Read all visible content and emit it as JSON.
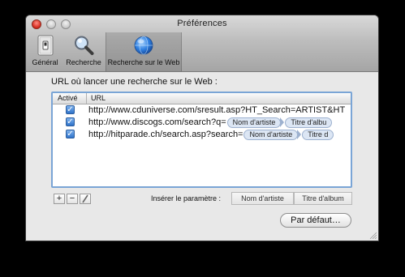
{
  "window": {
    "title": "Préférences"
  },
  "toolbar": {
    "items": [
      {
        "label": "Général",
        "icon": "general-switch-icon"
      },
      {
        "label": "Recherche",
        "icon": "magnifier-icon"
      },
      {
        "label": "Recherche sur le Web",
        "icon": "globe-icon",
        "selected": true
      }
    ]
  },
  "main": {
    "section_label": "URL où lancer une recherche sur le Web :",
    "table": {
      "columns": [
        "Activé",
        "URL"
      ],
      "rows": [
        {
          "active": true,
          "url_prefix": "http://www.cduniverse.com/sresult.asp?HT_Search=ARTIST&HT",
          "tokens": []
        },
        {
          "active": true,
          "url_prefix": "http://www.discogs.com/search?q=",
          "tokens": [
            "Nom d'artiste",
            "Titre d'albu"
          ]
        },
        {
          "active": true,
          "url_prefix": "http://hitparade.ch/search.asp?search=",
          "tokens": [
            "Nom d'artiste",
            "Titre d"
          ]
        }
      ]
    },
    "buttons": {
      "add": "+",
      "remove": "−"
    },
    "insert_label": "Insérer le paramètre :",
    "params": [
      "Nom d'artiste",
      "Titre d'album"
    ],
    "default_button": "Par défaut…"
  },
  "colors": {
    "selection_border": "#7aa5d6",
    "checkbox_blue": "#2f72c9",
    "token_fill": "#dce6f4"
  }
}
